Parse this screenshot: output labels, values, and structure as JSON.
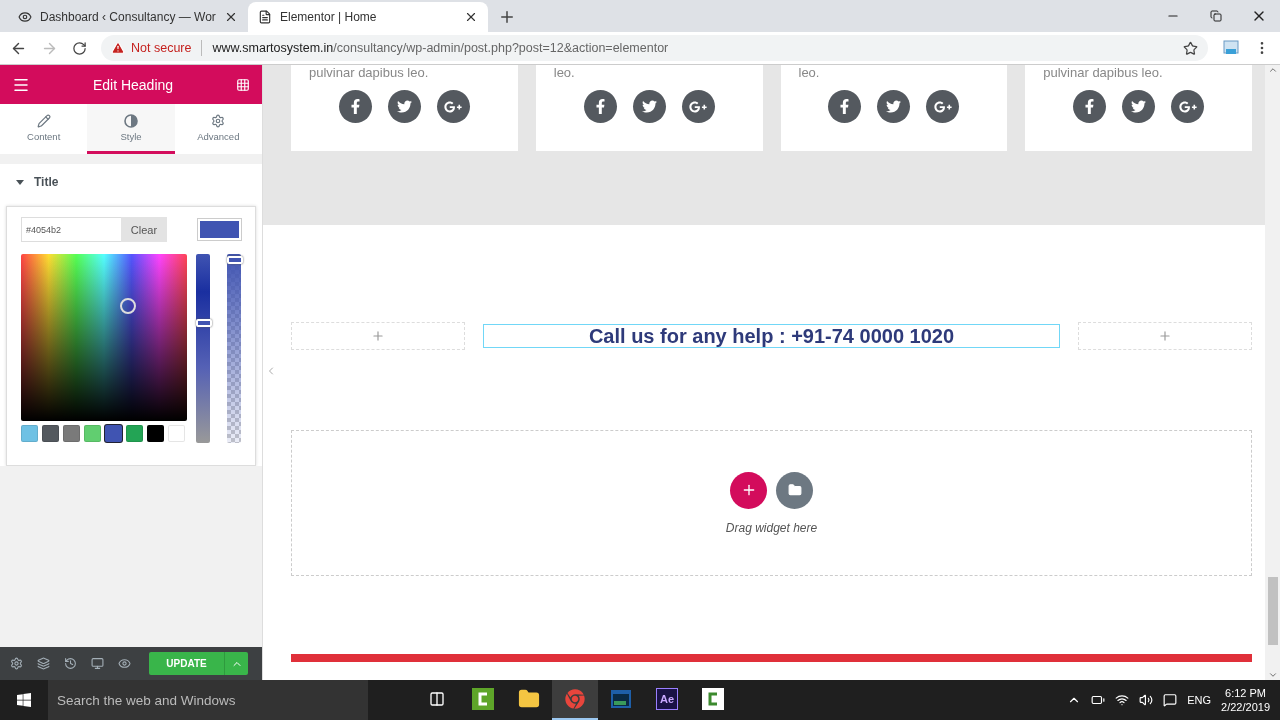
{
  "browser": {
    "tabs": [
      {
        "title": "Dashboard ‹ Consultancy — Wor",
        "kind": "eye",
        "selected": false
      },
      {
        "title": "Elementor | Home",
        "kind": "page",
        "selected": true
      }
    ],
    "address": {
      "security": "Not secure",
      "host": "www.smartosystem.in",
      "path": "/consultancy/wp-admin/post.php?post=12&action=elementor"
    }
  },
  "panel": {
    "title": "Edit Heading",
    "tabs": [
      {
        "label": "Content",
        "kind": "pencil",
        "selected": false
      },
      {
        "label": "Style",
        "kind": "contrast",
        "selected": true
      },
      {
        "label": "Advanced",
        "kind": "gear",
        "selected": false
      }
    ],
    "section": {
      "title": "Title",
      "expanded": true
    },
    "color_picker": {
      "value": "#4054b2",
      "clear": "Clear",
      "hue": {
        "level": 0.64
      },
      "alpha": {
        "level": 1
      },
      "swatches": [
        {
          "color": "#6ec1e4",
          "selected": false
        },
        {
          "color": "#54595f",
          "selected": false
        },
        {
          "color": "#7a7a7a",
          "selected": false
        },
        {
          "color": "#61ce70",
          "selected": false
        },
        {
          "color": "#4054b2",
          "selected": true
        },
        {
          "color": "#23a455",
          "selected": false
        },
        {
          "color": "#000000",
          "selected": false
        },
        {
          "color": "#ffffff",
          "selected": false
        }
      ]
    },
    "footer": {
      "update": "UPDATE"
    }
  },
  "canvas": {
    "cards": [
      {
        "text": "pulvinar dapibus leo."
      },
      {
        "text": "leo."
      },
      {
        "text": "leo."
      },
      {
        "text": "pulvinar dapibus leo."
      }
    ],
    "heading": "Call us for any help : +91-74 0000 1020",
    "drop_hint": "Drag widget here"
  },
  "taskbar": {
    "search": "Search the web and Windows",
    "apps": [
      {
        "kind": "taskview",
        "selected": false
      },
      {
        "kind": "camtasia",
        "selected": false
      },
      {
        "kind": "folder",
        "selected": false
      },
      {
        "kind": "chrome",
        "selected": true
      },
      {
        "kind": "window",
        "selected": false
      },
      {
        "kind": "ae",
        "label": "Ae",
        "selected": false
      },
      {
        "kind": "recorder",
        "selected": false
      }
    ],
    "language": "ENG",
    "time": "6:12 PM",
    "date": "2/22/2019"
  }
}
